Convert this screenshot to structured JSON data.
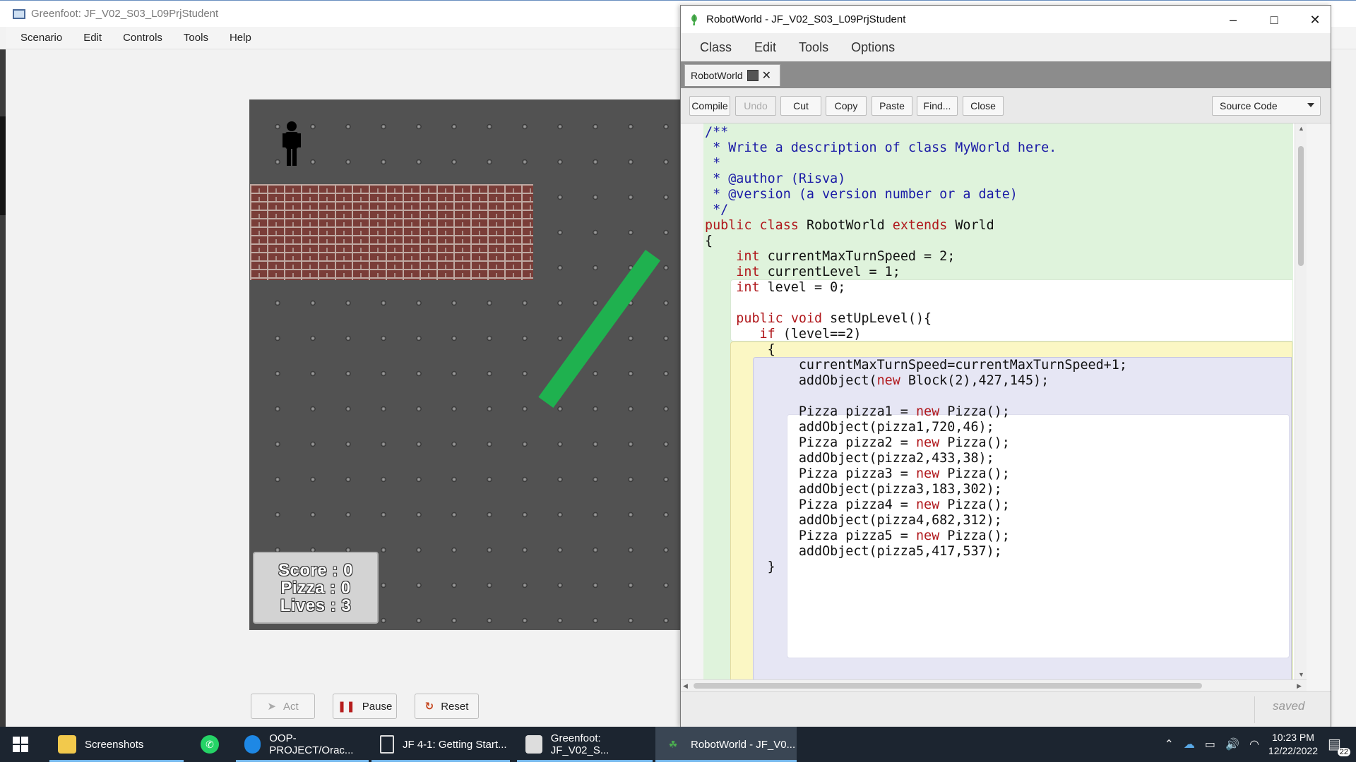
{
  "greenfoot": {
    "title": "Greenfoot: JF_V02_S03_L09PrjStudent",
    "menu": [
      "Scenario",
      "Edit",
      "Controls",
      "Tools",
      "Help"
    ],
    "score_panel": {
      "score": "Score : 0",
      "pizza": "Pizza : 0",
      "lives": "Lives : 3"
    },
    "controls": {
      "act": "Act",
      "pause": "Pause",
      "reset": "Reset"
    }
  },
  "editor": {
    "title": "RobotWorld - JF_V02_S03_L09PrjStudent",
    "menu": [
      "Class",
      "Edit",
      "Tools",
      "Options"
    ],
    "tab_label": "RobotWorld",
    "toolbar": [
      "Compile",
      "Undo",
      "Cut",
      "Copy",
      "Paste",
      "Find...",
      "Close"
    ],
    "view_mode": "Source Code",
    "status": "saved",
    "code": [
      "/**",
      " * Write a description of class MyWorld here.",
      " *",
      " * @author (Risva)",
      " * @version (a version number or a date)",
      " */",
      "public class RobotWorld extends World",
      "{",
      "    int currentMaxTurnSpeed = 2;",
      "    int currentLevel = 1;",
      "    int level = 0;",
      "",
      "    public void setUpLevel(){",
      "       if (level==2)",
      "        {",
      "            currentMaxTurnSpeed=currentMaxTurnSpeed+1;",
      "            addObject(new Block(2),427,145);",
      "",
      "            Pizza pizza1 = new Pizza();",
      "            addObject(pizza1,720,46);",
      "            Pizza pizza2 = new Pizza();",
      "            addObject(pizza2,433,38);",
      "            Pizza pizza3 = new Pizza();",
      "            addObject(pizza3,183,302);",
      "            Pizza pizza4 = new Pizza();",
      "            addObject(pizza4,682,312);",
      "            Pizza pizza5 = new Pizza();",
      "            addObject(pizza5,417,537);",
      "        }"
    ]
  },
  "taskbar": {
    "items": [
      {
        "label": "Screenshots",
        "icon": "folder-icon"
      },
      {
        "label": "",
        "icon": "whatsapp-icon"
      },
      {
        "label": "OOP-PROJECT/Orac...",
        "icon": "edge-icon"
      },
      {
        "label": "JF 4-1: Getting Start...",
        "icon": "document-icon"
      },
      {
        "label": "Greenfoot: JF_V02_S...",
        "icon": "greenfoot-icon"
      },
      {
        "label": "RobotWorld - JF_V0...",
        "icon": "greenfoot-editor-icon"
      }
    ],
    "clock_time": "10:23 PM",
    "clock_date": "12/22/2022",
    "notification_count": "22"
  },
  "colors": {
    "code_keyword": "#b0171b",
    "code_comment": "#1a1aa6",
    "class_scope": "#dff3dc",
    "method_scope": "#fbf7c4",
    "if_scope": "#e6e6f4",
    "green_bar": "#1fb14f",
    "taskbar": "#1c2530"
  }
}
